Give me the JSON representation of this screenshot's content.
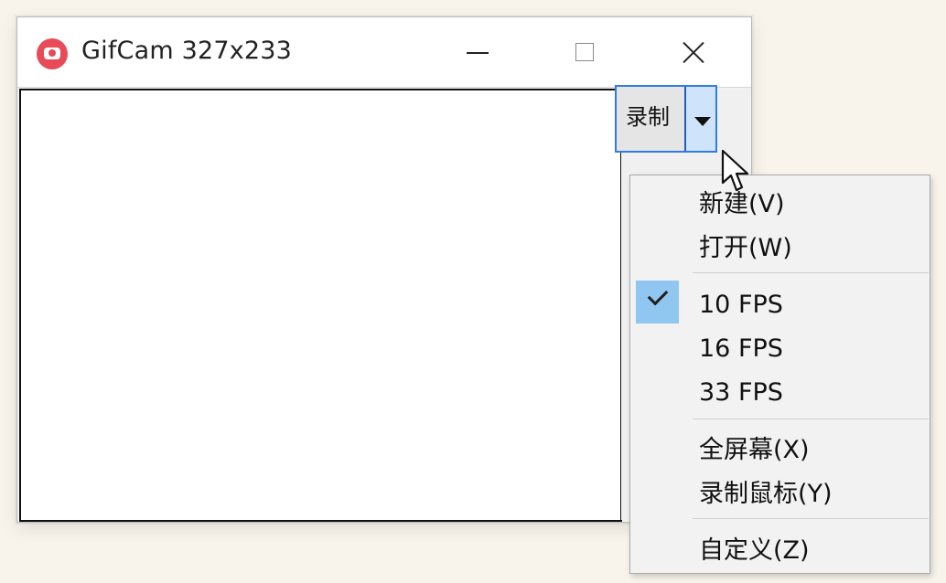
{
  "window": {
    "title": "GifCam 327x233"
  },
  "titlebar": {
    "minimize_icon": "minimize-icon",
    "maximize_icon": "maximize-icon",
    "close_icon": "close-icon"
  },
  "record_button": {
    "label": "录制",
    "dropdown_icon": "dropdown-arrow-icon"
  },
  "menu": {
    "items": [
      {
        "label": "新建(V)"
      },
      {
        "label": "打开(W)"
      },
      {
        "label": "10 FPS",
        "checked": true
      },
      {
        "label": "16 FPS"
      },
      {
        "label": "33 FPS"
      },
      {
        "label": "全屏幕(X)"
      },
      {
        "label": "录制鼠标(Y)"
      },
      {
        "label": "自定义(Z)"
      }
    ]
  },
  "colors": {
    "app_icon": "#e84b58",
    "button_border": "#2f7de1",
    "check_highlight": "#8fc7f0"
  }
}
